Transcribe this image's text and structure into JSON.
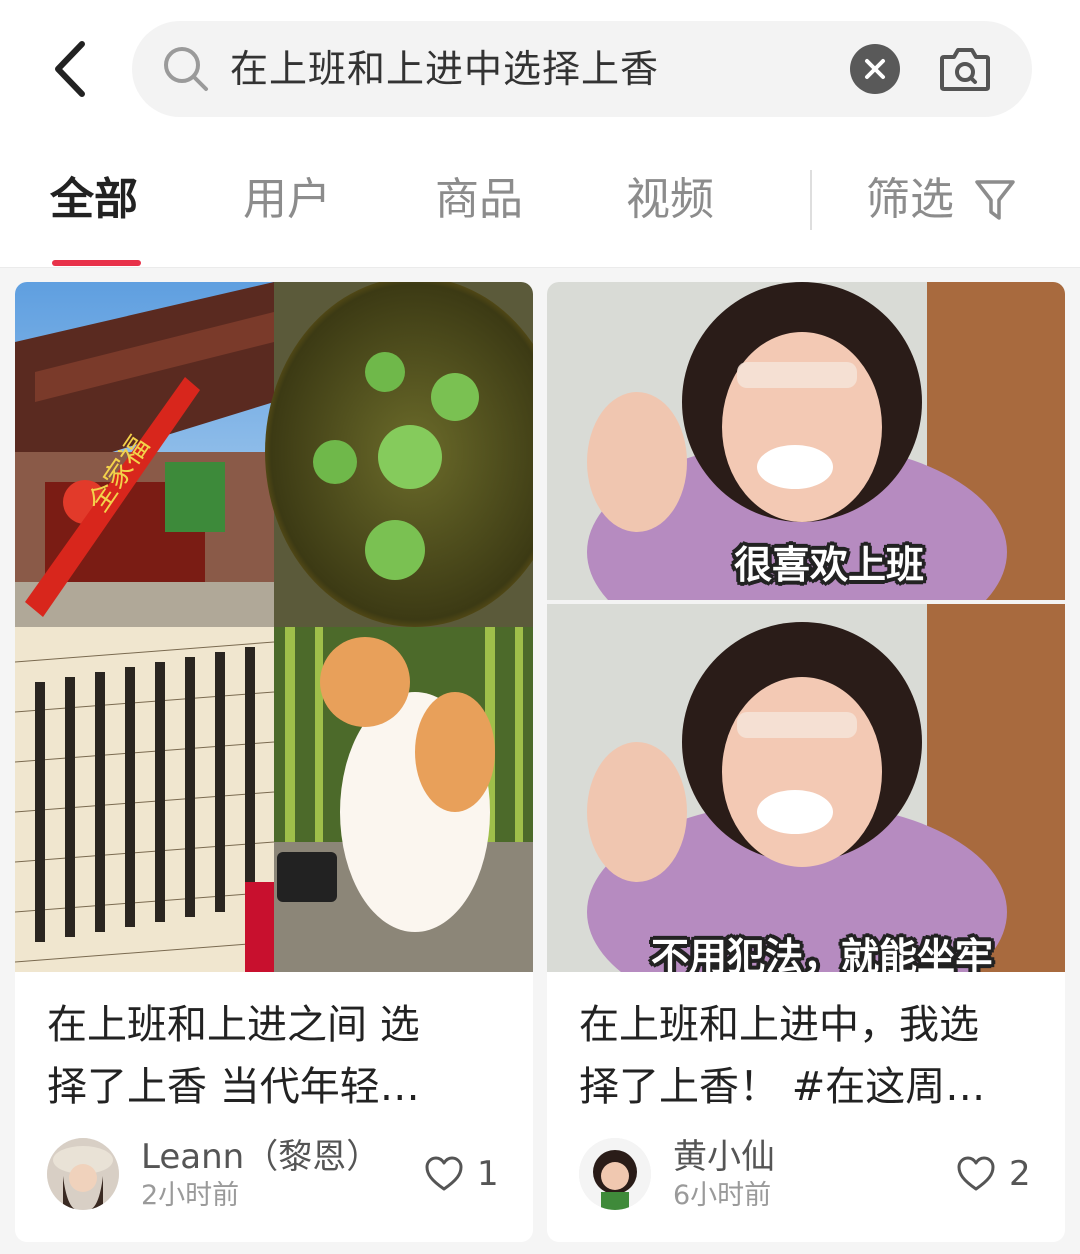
{
  "search": {
    "query": "在上班和上进中选择上香"
  },
  "tabs": [
    {
      "label": "全部"
    },
    {
      "label": "用户"
    },
    {
      "label": "商品"
    },
    {
      "label": "视频"
    }
  ],
  "filter_label": "筛选",
  "colors": {
    "accent": "#e8324a",
    "tab_inactive": "#8c8c8c"
  },
  "posts": [
    {
      "title_line1": "在上班和上进之间 选",
      "title_line2": "择了上香 当代年轻…",
      "author": "Leann（黎恩）",
      "time": "2小时前",
      "likes": "1",
      "image_text": [
        "全家福"
      ]
    },
    {
      "title_line1": "在上班和上进中，我选",
      "title_line2": "择了上香！ #在这周…",
      "author": "黄小仙",
      "time": "6小时前",
      "likes": "2",
      "captions": [
        "很喜欢上班",
        "不用犯法，就能坐牢"
      ]
    }
  ]
}
